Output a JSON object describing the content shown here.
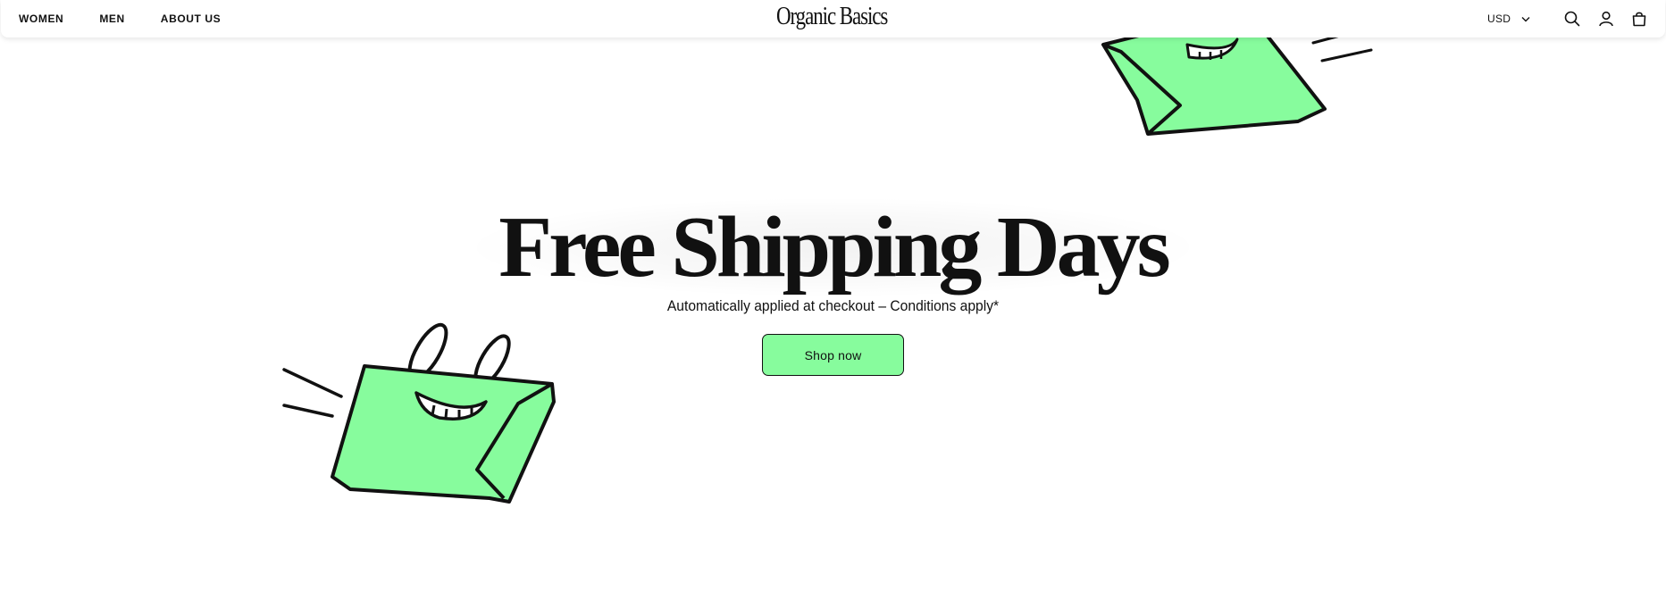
{
  "header": {
    "nav": [
      {
        "label": "WOMEN"
      },
      {
        "label": "MEN"
      },
      {
        "label": "ABOUT US"
      }
    ],
    "logo_text": "Organic Basics",
    "currency": "USD",
    "icons": [
      "search-icon",
      "account-icon",
      "cart-icon"
    ]
  },
  "hero": {
    "title": "Free Shipping Days",
    "subtitle": "Automatically applied at checkout – Conditions apply*",
    "button_label": "Shop now"
  },
  "colors": {
    "accent_green": "#87fc9d",
    "ink": "#111111",
    "background": "#ffffff"
  }
}
